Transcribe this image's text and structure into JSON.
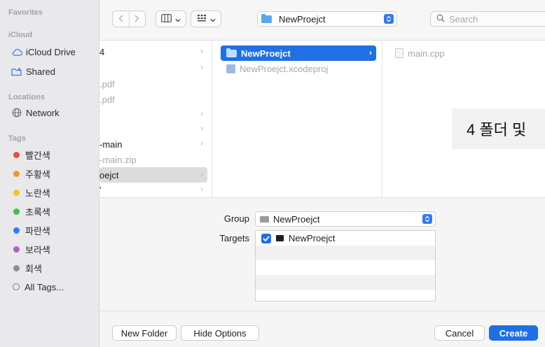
{
  "sidebar": {
    "headers": {
      "favorites": "Favorites",
      "icloud": "iCloud",
      "locations": "Locations",
      "tags": "Tags"
    },
    "icloud_items": [
      {
        "label": "iCloud Drive",
        "icon": "cloud-icon"
      },
      {
        "label": "Shared",
        "icon": "shared-folder-icon"
      }
    ],
    "location_items": [
      {
        "label": "Network",
        "icon": "network-icon"
      }
    ],
    "tags": [
      {
        "label": "빨간색",
        "color": "#f24b3f"
      },
      {
        "label": "주황색",
        "color": "#f6932c"
      },
      {
        "label": "노란색",
        "color": "#f5c518"
      },
      {
        "label": "초록색",
        "color": "#3ec24a"
      },
      {
        "label": "파란색",
        "color": "#2c7cf6"
      },
      {
        "label": "보라색",
        "color": "#b35bd6"
      },
      {
        "label": "회색",
        "color": "#8e8e93"
      }
    ],
    "all_tags": "All Tags..."
  },
  "toolbar": {
    "back_icon": "chevron-left-icon",
    "forward_icon": "chevron-right-icon",
    "view_icon": "column-view-icon",
    "group_icon": "grid-group-icon",
    "path_location": "NewProejct",
    "search_placeholder": "Search"
  },
  "columns": {
    "col1": [
      {
        "label": "4",
        "arrow": true,
        "state": "normal"
      },
      {
        "label": "",
        "arrow": true,
        "state": "normal"
      },
      {
        "label": ".pdf",
        "arrow": false,
        "state": "dim"
      },
      {
        "label": ".pdf",
        "arrow": false,
        "state": "dim"
      },
      {
        "label": "",
        "arrow": true,
        "state": "normal"
      },
      {
        "label": "",
        "arrow": true,
        "state": "normal"
      },
      {
        "label": "-main",
        "arrow": true,
        "state": "normal"
      },
      {
        "label": "-main.zip",
        "arrow": false,
        "state": "dim"
      },
      {
        "label": "oejct",
        "arrow": true,
        "state": "selected-gray"
      },
      {
        "label": "'",
        "arrow": true,
        "state": "normal"
      }
    ],
    "col2": [
      {
        "label": "NewProejct",
        "icon": "folder-icon",
        "arrow": true,
        "state": "selected-blue"
      },
      {
        "label": "NewProejct.xcodeproj",
        "icon": "xcodeproj-icon",
        "arrow": false,
        "state": "dim"
      }
    ],
    "col3": [
      {
        "label": "main.cpp",
        "icon": "file-icon",
        "state": "dim"
      }
    ]
  },
  "overlay": {
    "text": "4 폴더 및"
  },
  "options": {
    "group_label": "Group",
    "group_value": "NewProejct",
    "targets_label": "Targets",
    "targets": [
      {
        "label": "NewProejct",
        "checked": true
      }
    ]
  },
  "buttons": {
    "new_folder": "New Folder",
    "hide_options": "Hide Options",
    "cancel": "Cancel",
    "create": "Create"
  },
  "colors": {
    "accent": "#1f6fe5",
    "sidebar_bg": "#e9e8ea"
  }
}
